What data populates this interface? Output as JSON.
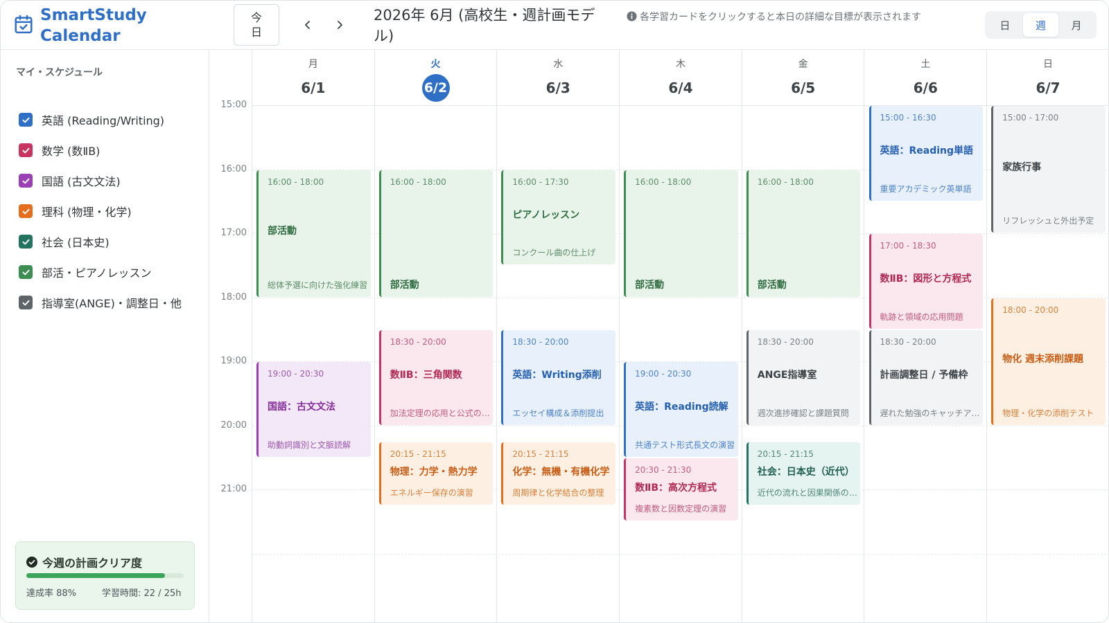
{
  "app": {
    "title": "SmartStudy Calendar"
  },
  "toolbar": {
    "today_label": "今日",
    "title": "2026年 6月 (高校生・週計画モデル)",
    "hint": "各学習カードをクリックすると本日の詳細な目標が表示されます",
    "views": [
      "日",
      "週",
      "月"
    ],
    "active_view": "週"
  },
  "sidebar": {
    "heading": "マイ・スケジュール",
    "calendars": [
      {
        "label": "英語 (Reading/Writing)",
        "color": "#2f6fc6",
        "checked": true
      },
      {
        "label": "数学 (数ⅡB)",
        "color": "#c73462",
        "checked": true
      },
      {
        "label": "国語 (古文文法)",
        "color": "#9b3fb5",
        "checked": true
      },
      {
        "label": "理科 (物理・化学)",
        "color": "#e46d1e",
        "checked": true
      },
      {
        "label": "社会 (日本史)",
        "color": "#22735f",
        "checked": true
      },
      {
        "label": "部活・ピアノレッスン",
        "color": "#3d8c52",
        "checked": true
      },
      {
        "label": "指導室(ANGE)・調整日・他",
        "color": "#5f6469",
        "checked": true
      }
    ],
    "progress": {
      "title": "今週の計画クリア度",
      "rate_label": "達成率 88%",
      "hours_label": "学習時間: 22 / 25h",
      "rate_percent": 88
    }
  },
  "grid": {
    "hours": [
      "15:00",
      "16:00",
      "17:00",
      "18:00",
      "19:00",
      "20:00",
      "21:00"
    ],
    "days": [
      {
        "dow": "月",
        "date": "6/1",
        "today": false
      },
      {
        "dow": "火",
        "date": "6/2",
        "today": true
      },
      {
        "dow": "水",
        "date": "6/3",
        "today": false
      },
      {
        "dow": "木",
        "date": "6/4",
        "today": false
      },
      {
        "dow": "金",
        "date": "6/5",
        "today": false
      },
      {
        "dow": "土",
        "date": "6/6",
        "today": false
      },
      {
        "dow": "日",
        "date": "6/7",
        "today": false
      }
    ]
  },
  "events": [
    {
      "day": 0,
      "time": "16:00 - 18:00",
      "title": "部活動",
      "sub": "総体予選に向けた強化練習",
      "cat": "club"
    },
    {
      "day": 0,
      "time": "19:00 - 20:30",
      "title": "国語：古文文法",
      "sub": "助動詞識別と文脈読解",
      "cat": "jp"
    },
    {
      "day": 1,
      "time": "16:00 - 18:00",
      "title": "部活動",
      "sub": "",
      "cat": "club"
    },
    {
      "day": 1,
      "time": "18:30 - 20:00",
      "title": "数ⅡB：三角関数",
      "sub": "加法定理の応用と公式の導出",
      "cat": "math"
    },
    {
      "day": 1,
      "time": "20:15 - 21:15",
      "title": "物理：力学・熱力学",
      "sub": "エネルギー保存の演習",
      "cat": "sci"
    },
    {
      "day": 2,
      "time": "16:00 - 17:30",
      "title": "ピアノレッスン",
      "sub": "コンクール曲の仕上げ",
      "cat": "club"
    },
    {
      "day": 2,
      "time": "18:30 - 20:00",
      "title": "英語：Writing添削",
      "sub": "エッセイ構成＆添削提出",
      "cat": "eng"
    },
    {
      "day": 2,
      "time": "20:15 - 21:15",
      "title": "化学：無機・有機化学",
      "sub": "周期律と化学結合の整理",
      "cat": "sci"
    },
    {
      "day": 3,
      "time": "16:00 - 18:00",
      "title": "部活動",
      "sub": "",
      "cat": "club"
    },
    {
      "day": 3,
      "time": "19:00 - 20:30",
      "title": "英語：Reading読解",
      "sub": "共通テスト形式長文の演習",
      "cat": "eng"
    },
    {
      "day": 3,
      "time": "20:30 - 21:30",
      "title": "数ⅡB：高次方程式",
      "sub": "複素数と因数定理の演習",
      "cat": "math"
    },
    {
      "day": 4,
      "time": "16:00 - 18:00",
      "title": "部活動",
      "sub": "",
      "cat": "club"
    },
    {
      "day": 4,
      "time": "18:30 - 20:00",
      "title": "ANGE指導室",
      "sub": "週次進捗確認と課題質問",
      "cat": "other"
    },
    {
      "day": 4,
      "time": "20:15 - 21:15",
      "title": "社会：日本史（近代）",
      "sub": "近代の流れと因果関係の整理",
      "cat": "soc"
    },
    {
      "day": 5,
      "time": "15:00 - 16:30",
      "title": "英語：Reading単語",
      "sub": "重要アカデミック英単語",
      "cat": "eng"
    },
    {
      "day": 5,
      "time": "17:00 - 18:30",
      "title": "数ⅡB：図形と方程式",
      "sub": "軌跡と領域の応用問題",
      "cat": "math"
    },
    {
      "day": 5,
      "time": "18:30 - 20:00",
      "title": "計画調整日 / 予備枠",
      "sub": "遅れた勉強のキャッチアップ",
      "cat": "other"
    },
    {
      "day": 6,
      "time": "15:00 - 17:00",
      "title": "家族行事",
      "sub": "リフレッシュと外出予定",
      "cat": "other"
    },
    {
      "day": 6,
      "time": "18:00 - 20:00",
      "title": "物化 週末添削課題",
      "sub": "物理・化学の添削テスト",
      "cat": "sci"
    }
  ]
}
